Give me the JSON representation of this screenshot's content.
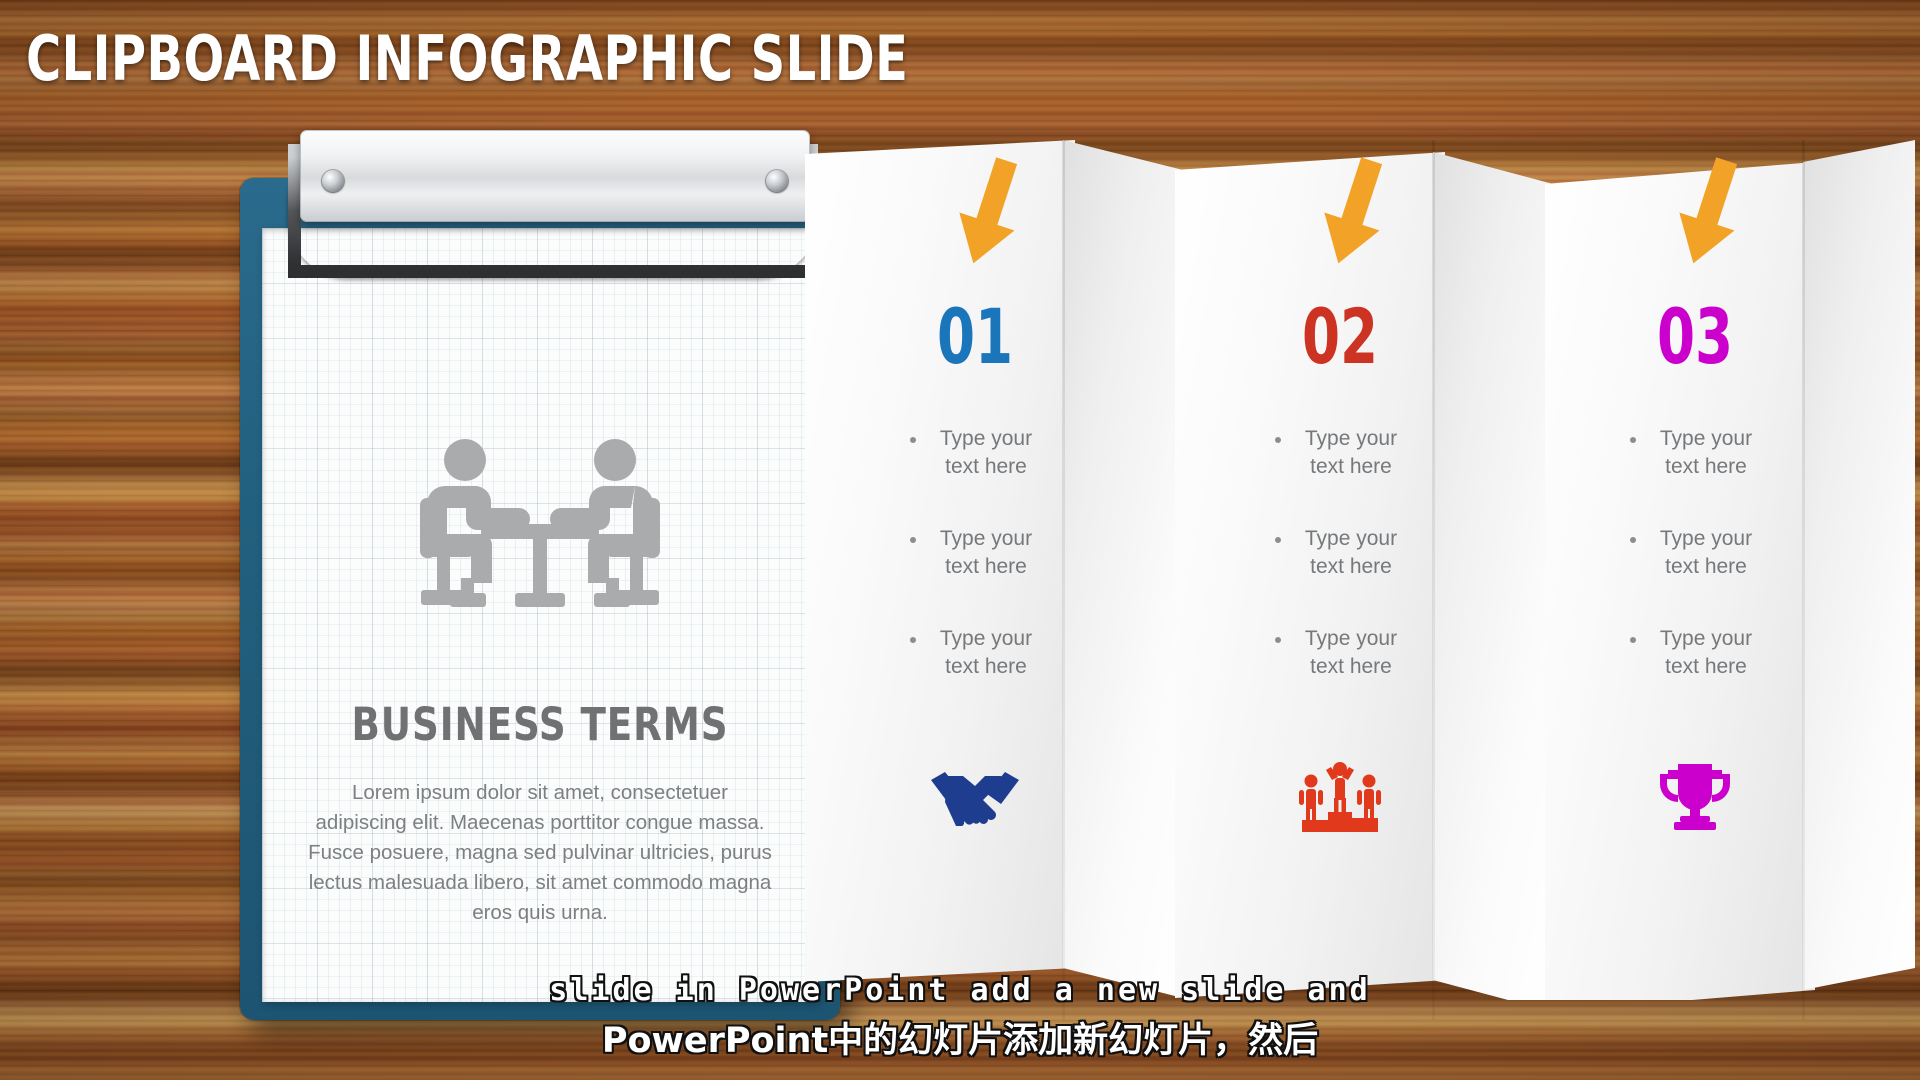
{
  "title": "CLIPBOARD INFOGRAPHIC SLIDE",
  "clipboard": {
    "icon": "meeting-table-people-icon",
    "heading": "BUSINESS TERMS",
    "paragraph": "Lorem ipsum dolor sit amet, consectetuer adipiscing elit. Maecenas porttitor congue massa. Fusce posuere, magna sed pulvinar ultricies, purus lectus malesuada libero, sit amet commodo magna eros quis urna.",
    "board_color": "#22607f",
    "paper_color": "#fbfcfc"
  },
  "columns": [
    {
      "number": "01",
      "color": "#1b75bb",
      "arrow_color": "#f2a227",
      "icon": "handshake-icon",
      "icon_color": "#1f3d8f",
      "bullets": [
        {
          "line1": "Type your",
          "line2": "text here"
        },
        {
          "line1": "Type your",
          "line2": "text here"
        },
        {
          "line1": "Type your",
          "line2": "text here"
        }
      ]
    },
    {
      "number": "02",
      "color": "#cc3322",
      "arrow_color": "#f2a227",
      "icon": "winners-podium-icon",
      "icon_color": "#e0391c",
      "bullets": [
        {
          "line1": "Type your",
          "line2": "text here"
        },
        {
          "line1": "Type your",
          "line2": "text here"
        },
        {
          "line1": "Type your",
          "line2": "text here"
        }
      ]
    },
    {
      "number": "03",
      "color": "#cc00cc",
      "arrow_color": "#f2a227",
      "icon": "trophy-icon",
      "icon_color": "#cc00cc",
      "bullets": [
        {
          "line1": "Type your",
          "line2": "text here"
        },
        {
          "line1": "Type your",
          "line2": "text here"
        },
        {
          "line1": "Type your",
          "line2": "text here"
        }
      ]
    }
  ],
  "subtitles": {
    "english": "slide in PowerPoint add a new slide and",
    "chinese": "PowerPoint中的幻灯片添加新幻灯片，然后"
  }
}
